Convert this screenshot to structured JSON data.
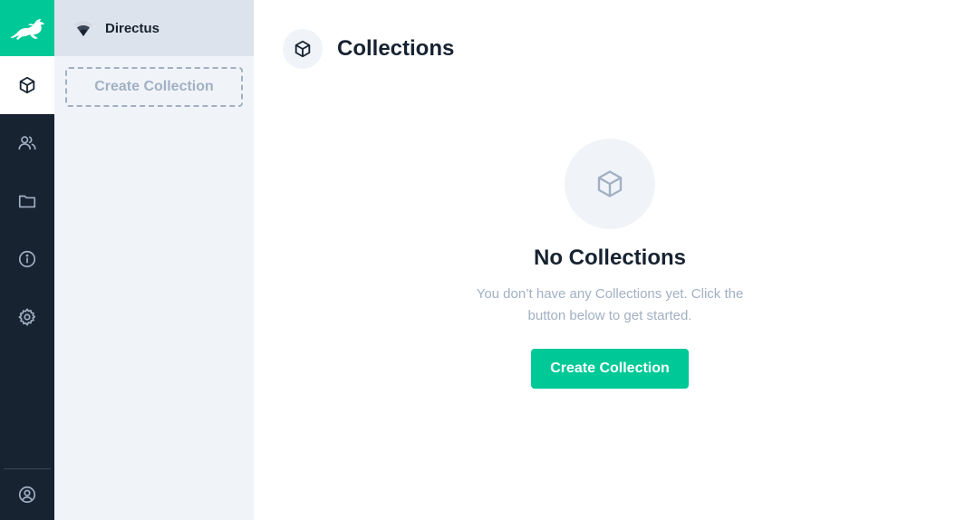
{
  "project": {
    "name": "Directus"
  },
  "modules": [
    {
      "icon": "box-icon",
      "active": true
    },
    {
      "icon": "users-icon",
      "active": false
    },
    {
      "icon": "folder-icon",
      "active": false
    },
    {
      "icon": "info-icon",
      "active": false
    },
    {
      "icon": "settings-icon",
      "active": false
    }
  ],
  "nav": {
    "create_label": "Create Collection"
  },
  "header": {
    "title": "Collections",
    "icon": "box-icon"
  },
  "empty_state": {
    "title": "No Collections",
    "text": "You don’t have any Collections yet. Click the button below to get started.",
    "button_label": "Create Collection",
    "icon": "box-icon"
  },
  "colors": {
    "accent": "#00c897",
    "dark": "#172331",
    "muted": "#a2b0c3",
    "panel": "#f0f4f9"
  }
}
